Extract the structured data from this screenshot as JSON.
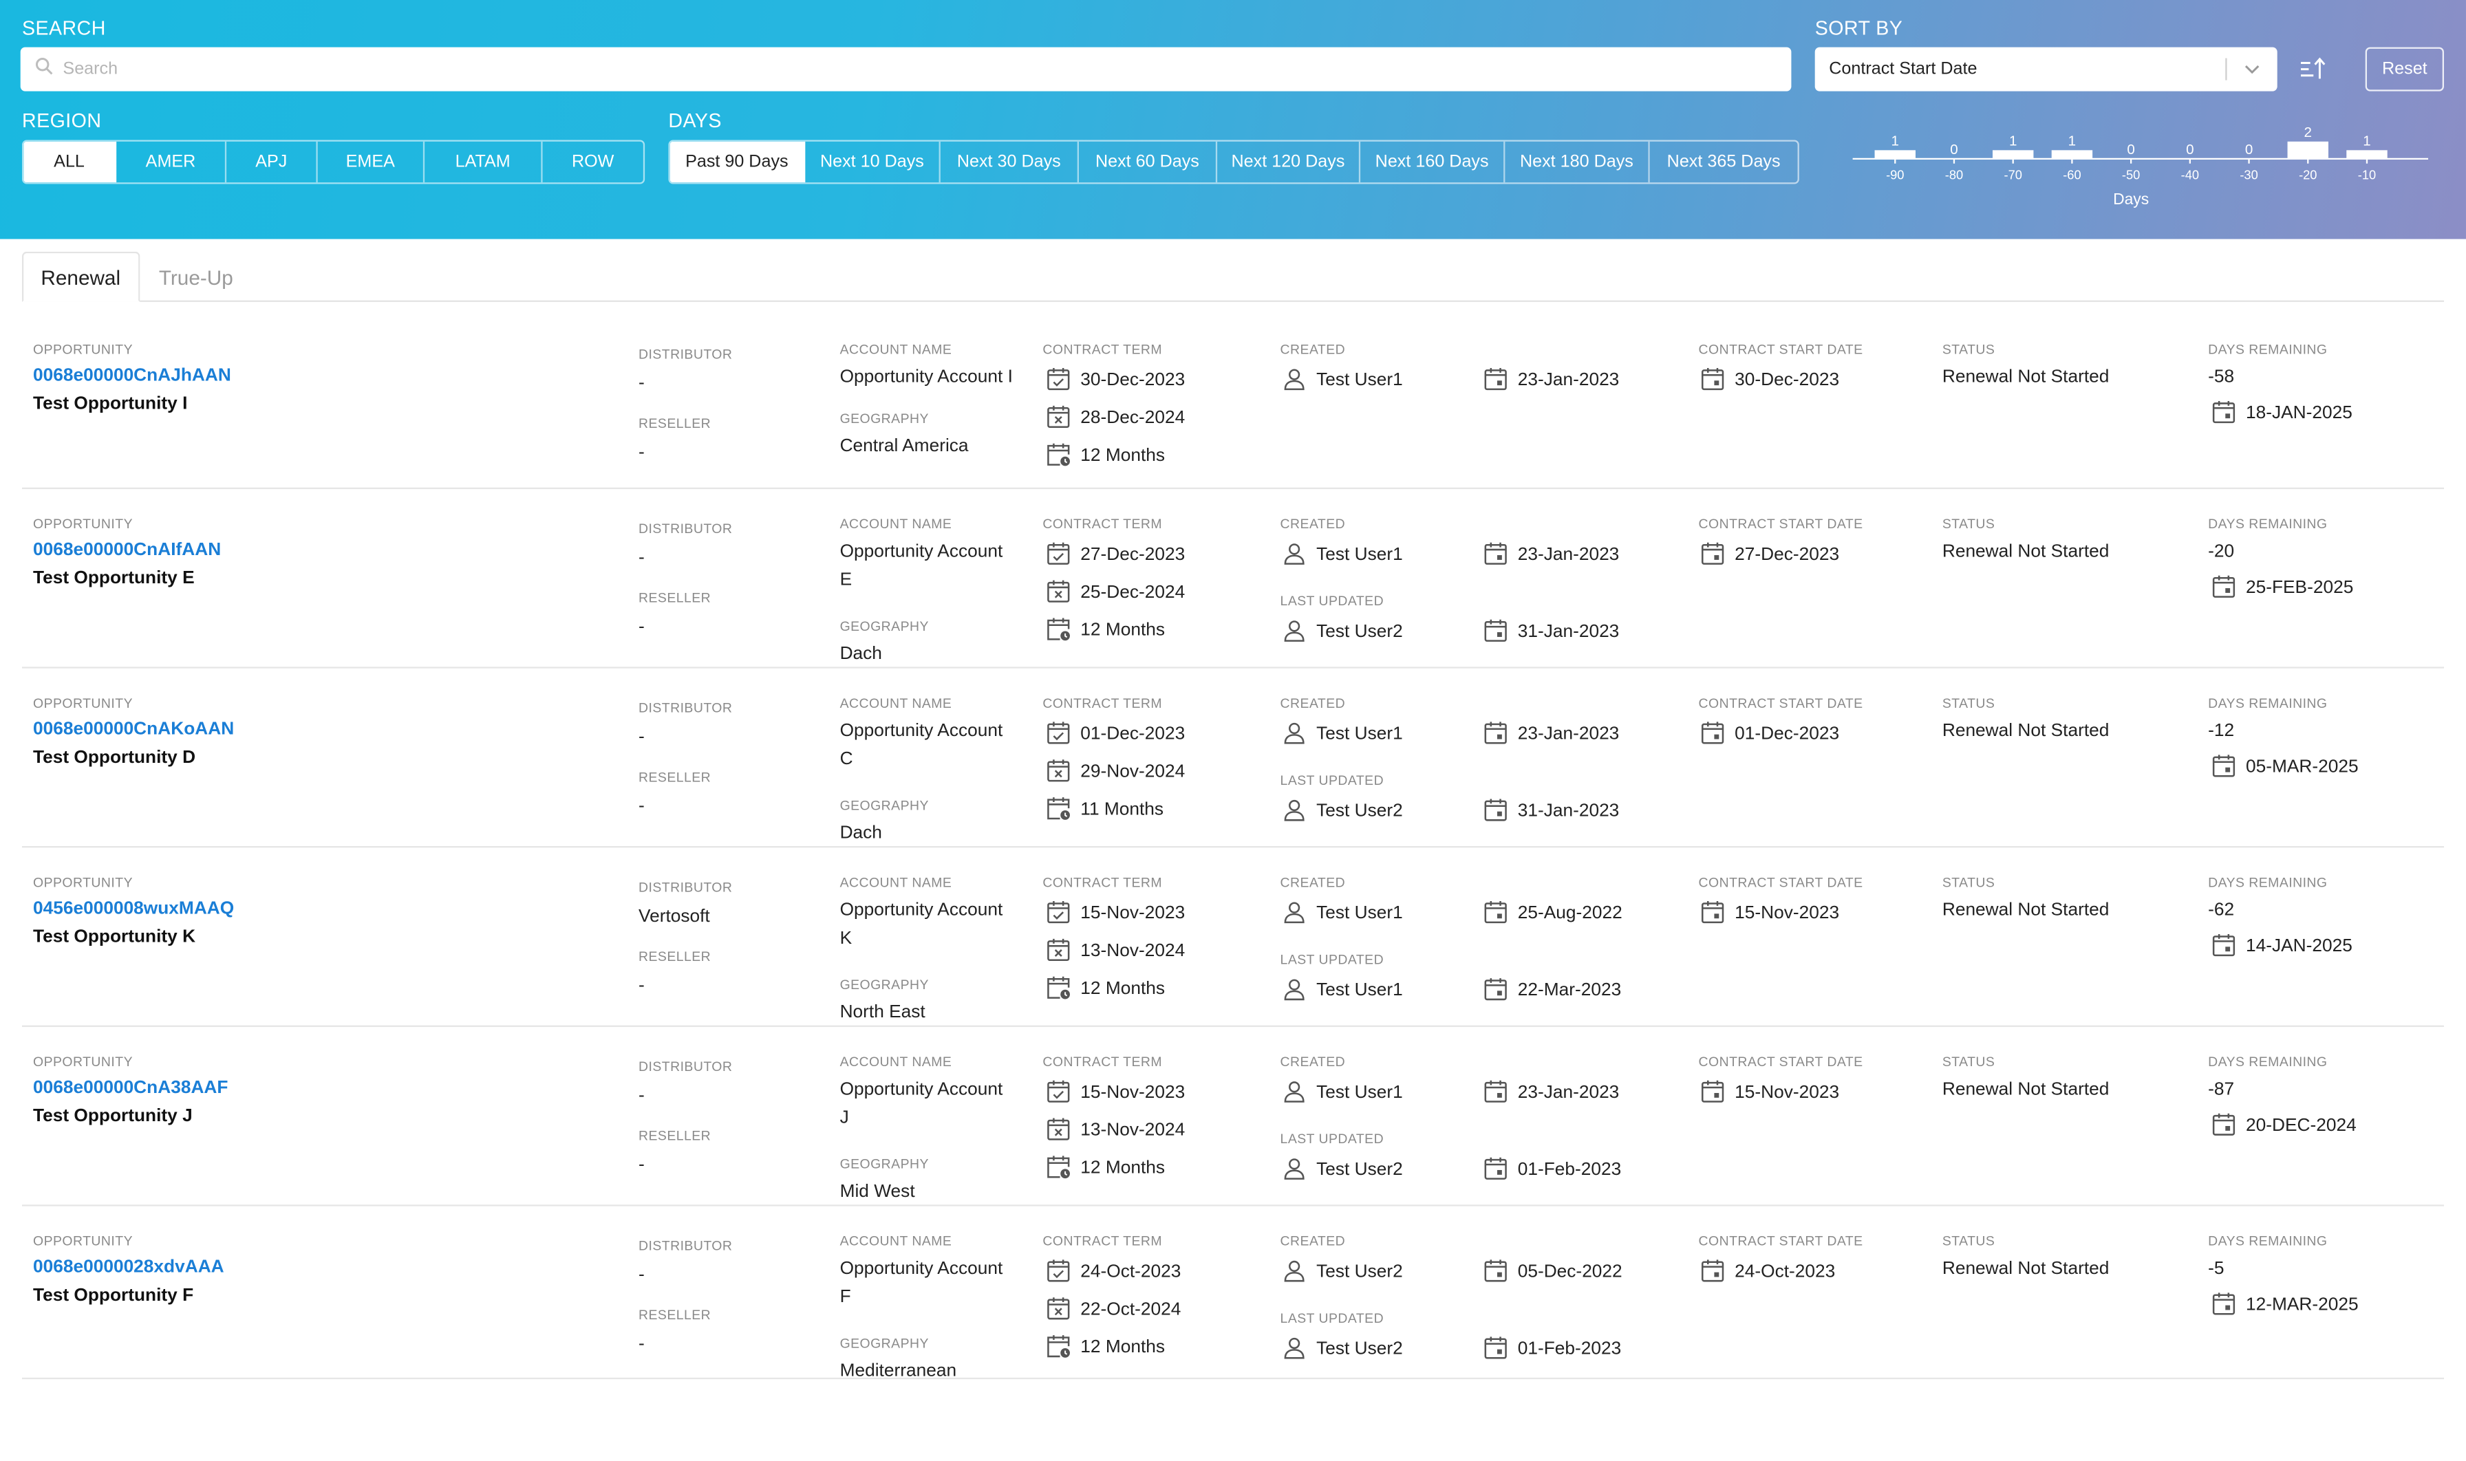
{
  "filters": {
    "search_label": "SEARCH",
    "search_placeholder": "Search",
    "sort_label": "SORT BY",
    "sort_value": "Contract Start Date",
    "reset_label": "Reset",
    "region_label": "REGION",
    "regions": [
      "ALL",
      "AMER",
      "APJ",
      "EMEA",
      "LATAM",
      "ROW"
    ],
    "region_selected": "ALL",
    "days_label": "DAYS",
    "days_options": [
      "Past 90 Days",
      "Next 10 Days",
      "Next 30 Days",
      "Next 60 Days",
      "Next 120 Days",
      "Next 160 Days",
      "Next 180 Days",
      "Next 365 Days"
    ],
    "days_selected": "Past 90 Days"
  },
  "chart_data": {
    "type": "bar",
    "categories": [
      "-90",
      "-80",
      "-70",
      "-60",
      "-50",
      "-40",
      "-30",
      "-20",
      "-10"
    ],
    "values": [
      1,
      0,
      1,
      1,
      0,
      0,
      0,
      2,
      1
    ],
    "xlabel": "Days",
    "ylabel": "",
    "ylim": [
      0,
      2
    ]
  },
  "tabs": [
    "Renewal",
    "True-Up"
  ],
  "tab_active": "Renewal",
  "labels": {
    "opportunity": "OPPORTUNITY",
    "distributor": "DISTRIBUTOR",
    "reseller": "RESELLER",
    "account_name": "ACCOUNT NAME",
    "geography": "GEOGRAPHY",
    "contract_term": "CONTRACT TERM",
    "created": "CREATED",
    "last_updated": "LAST UPDATED",
    "contract_start_date": "CONTRACT START DATE",
    "status": "STATUS",
    "days_remaining": "DAYS REMAINING"
  },
  "rows": [
    {
      "id": "0068e00000CnAJhAAN",
      "name": "Test Opportunity I",
      "distributor": "-",
      "reseller": "-",
      "account_lines": [
        "Opportunity Account I"
      ],
      "geography": "Central America",
      "term_start": "30-Dec-2023",
      "term_end": "28-Dec-2024",
      "term_length": "12 Months",
      "created_user": "Test User1",
      "created_date": "23-Jan-2023",
      "updated_user": null,
      "updated_date": null,
      "contract_start": "30-Dec-2023",
      "status": "Renewal Not Started",
      "days_remaining": "-58",
      "renewal_date": "18-JAN-2025"
    },
    {
      "id": "0068e00000CnAIfAAN",
      "name": "Test Opportunity E",
      "distributor": "-",
      "reseller": "-",
      "account_lines": [
        "Opportunity Account",
        "E"
      ],
      "geography": "Dach",
      "term_start": "27-Dec-2023",
      "term_end": "25-Dec-2024",
      "term_length": "12 Months",
      "created_user": "Test User1",
      "created_date": "23-Jan-2023",
      "updated_user": "Test User2",
      "updated_date": "31-Jan-2023",
      "contract_start": "27-Dec-2023",
      "status": "Renewal Not Started",
      "days_remaining": "-20",
      "renewal_date": "25-FEB-2025"
    },
    {
      "id": "0068e00000CnAKoAAN",
      "name": "Test Opportunity D",
      "distributor": "-",
      "reseller": "-",
      "account_lines": [
        "Opportunity Account",
        "C"
      ],
      "geography": "Dach",
      "term_start": "01-Dec-2023",
      "term_end": "29-Nov-2024",
      "term_length": "11 Months",
      "created_user": "Test User1",
      "created_date": "23-Jan-2023",
      "updated_user": "Test User2",
      "updated_date": "31-Jan-2023",
      "contract_start": "01-Dec-2023",
      "status": "Renewal Not Started",
      "days_remaining": "-12",
      "renewal_date": "05-MAR-2025"
    },
    {
      "id": "0456e000008wuxMAAQ",
      "name": "Test Opportunity K",
      "distributor": "Vertosoft",
      "reseller": "-",
      "account_lines": [
        "Opportunity Account",
        "K"
      ],
      "geography": "North East",
      "term_start": "15-Nov-2023",
      "term_end": "13-Nov-2024",
      "term_length": "12 Months",
      "created_user": "Test User1",
      "created_date": "25-Aug-2022",
      "updated_user": "Test User1",
      "updated_date": "22-Mar-2023",
      "contract_start": "15-Nov-2023",
      "status": "Renewal Not Started",
      "days_remaining": "-62",
      "renewal_date": "14-JAN-2025"
    },
    {
      "id": "0068e00000CnA38AAF",
      "name": "Test Opportunity J",
      "distributor": "-",
      "reseller": "-",
      "account_lines": [
        "Opportunity Account",
        "J"
      ],
      "geography": "Mid West",
      "term_start": "15-Nov-2023",
      "term_end": "13-Nov-2024",
      "term_length": "12 Months",
      "created_user": "Test User1",
      "created_date": "23-Jan-2023",
      "updated_user": "Test User2",
      "updated_date": "01-Feb-2023",
      "contract_start": "15-Nov-2023",
      "status": "Renewal Not Started",
      "days_remaining": "-87",
      "renewal_date": "20-DEC-2024"
    },
    {
      "id": "0068e0000028xdvAAA",
      "name": "Test Opportunity F",
      "distributor": "-",
      "reseller": "-",
      "account_lines": [
        "Opportunity Account",
        "F"
      ],
      "geography": "Mediterranean",
      "term_start": "24-Oct-2023",
      "term_end": "22-Oct-2024",
      "term_length": "12 Months",
      "created_user": "Test User2",
      "created_date": "05-Dec-2022",
      "updated_user": "Test User2",
      "updated_date": "01-Feb-2023",
      "contract_start": "24-Oct-2023",
      "status": "Renewal Not Started",
      "days_remaining": "-5",
      "renewal_date": "12-MAR-2025"
    }
  ]
}
